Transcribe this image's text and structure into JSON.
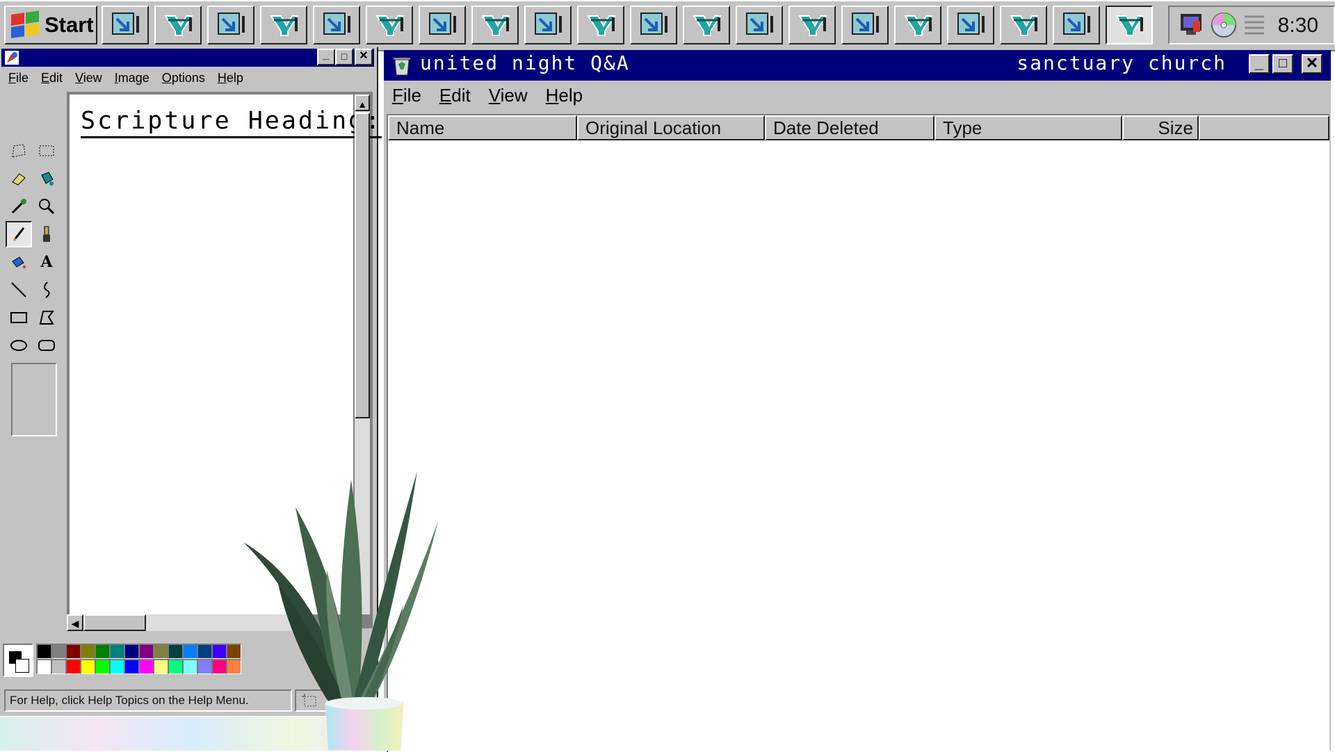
{
  "taskbar": {
    "start_label": "Start",
    "task_count": 20,
    "clock": "8:30"
  },
  "paint": {
    "menu": [
      "File",
      "Edit",
      "View",
      "Image",
      "Options",
      "Help"
    ],
    "canvas_text": "Scripture Heading:",
    "status": "For Help, click Help Topics on the Help Menu.",
    "palette_top": [
      "#000000",
      "#808080",
      "#800000",
      "#808000",
      "#008000",
      "#008080",
      "#000080",
      "#800080",
      "#808040",
      "#004040",
      "#0080ff",
      "#004080",
      "#4000ff",
      "#804000"
    ],
    "palette_bottom": [
      "#ffffff",
      "#c0c0c0",
      "#ff0000",
      "#ffff00",
      "#00ff00",
      "#00ffff",
      "#0000ff",
      "#ff00ff",
      "#ffff80",
      "#00ff80",
      "#80ffff",
      "#8080ff",
      "#ff0080",
      "#ff8040"
    ]
  },
  "recycle": {
    "title": "united night Q&A",
    "title_right": "sanctuary church",
    "menu": [
      "File",
      "Edit",
      "View",
      "Help"
    ],
    "columns": [
      "Name",
      "Original Location",
      "Date Deleted",
      "Type",
      "Size"
    ]
  },
  "colors": {
    "titlebar": "#00007a",
    "chrome": "#c3c3c3"
  }
}
